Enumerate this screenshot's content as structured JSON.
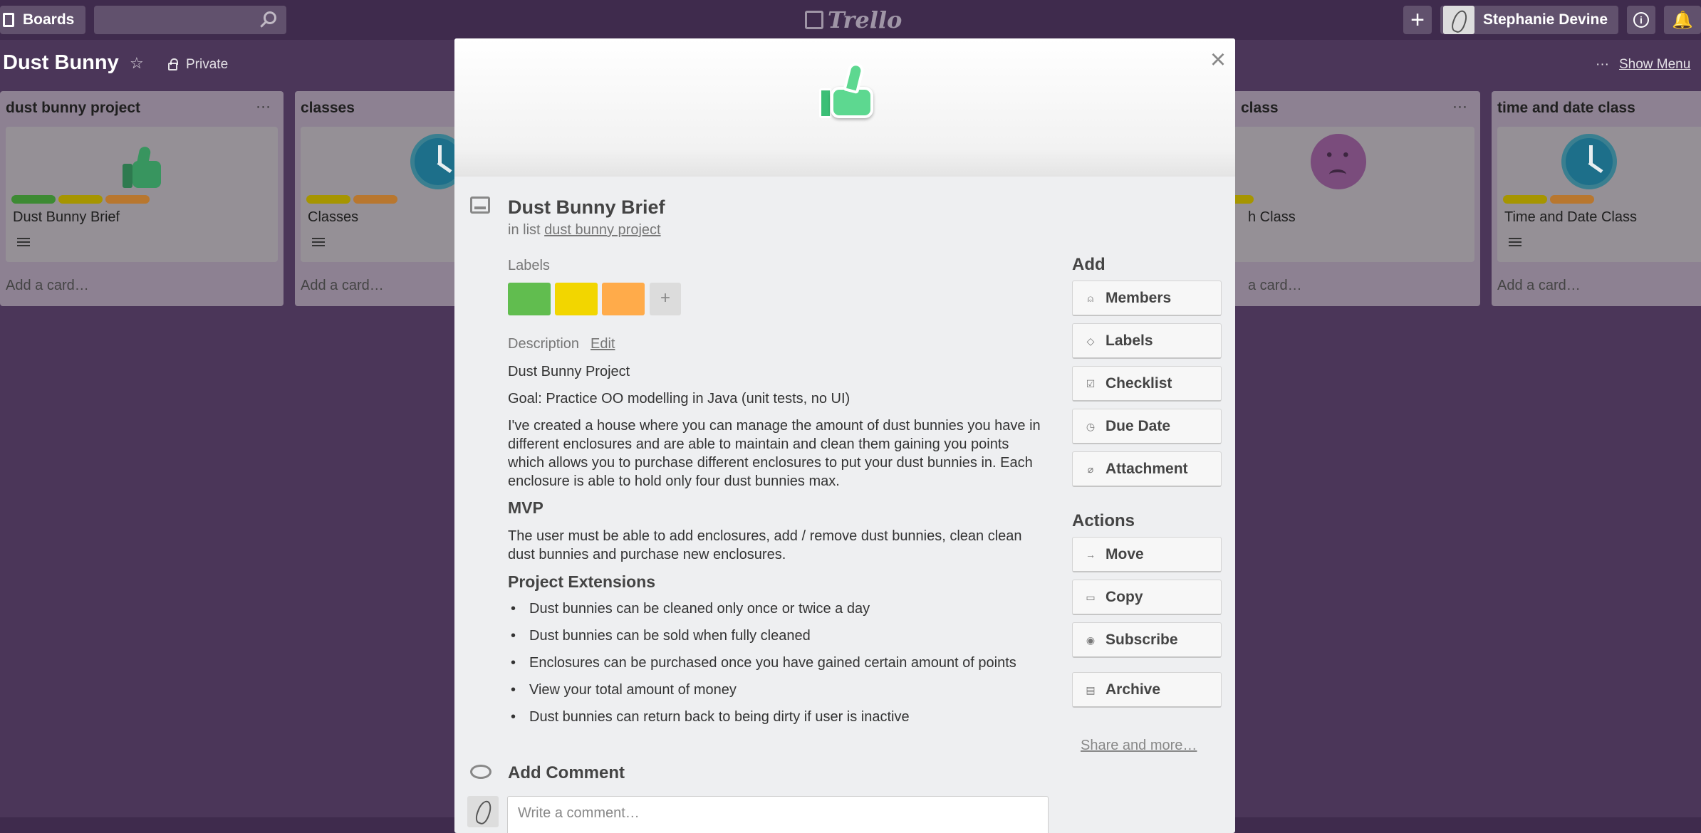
{
  "header": {
    "boards_label": "Boards",
    "logo_text": "Trello",
    "user_name": "Stephanie Devine"
  },
  "board": {
    "title": "Dust Bunny",
    "visibility": "Private",
    "show_menu": "Show Menu"
  },
  "lists": [
    {
      "title": "dust bunny project",
      "card_title": "Dust Bunny Brief",
      "add_card": "Add a card…",
      "cover": "thumbs-up-icon",
      "labels": [
        "#61bd4f",
        "#f2d600",
        "#ffab4a"
      ]
    },
    {
      "title": "classes",
      "card_title": "Classes",
      "add_card": "Add a card…",
      "cover": "clock-icon",
      "labels": [
        "#f2d600",
        "#ffab4a"
      ]
    },
    {
      "title": "class",
      "card_title": "h Class",
      "add_card": "a card…",
      "cover": "sad-face-icon",
      "labels": [
        "#f2d600"
      ]
    },
    {
      "title": "time and date class",
      "card_title": "Time and Date Class",
      "add_card": "Add a card…",
      "cover": "clock-icon",
      "labels": [
        "#f2d600",
        "#ffab4a"
      ]
    }
  ],
  "modal": {
    "title": "Dust Bunny Brief",
    "in_list_prefix": "in list",
    "list_name": "dust bunny project",
    "labels_heading": "Labels",
    "label_colors": [
      "#61bd4f",
      "#f2d600",
      "#ffab4a"
    ],
    "description_heading": "Description",
    "edit_label": "Edit",
    "description": {
      "line1": "Dust Bunny Project",
      "line2": "Goal: Practice OO modelling in Java (unit tests, no UI)",
      "paragraph": "I've created a house where you can manage the amount of dust bunnies you have in different enclosures and are able to maintain and clean them gaining you points which allows you to purchase different enclosures to put your dust bunnies in. Each enclosure is able to hold only four dust bunnies max.",
      "mvp_heading": "MVP",
      "mvp_text": "The user must be able to add enclosures, add / remove dust bunnies, clean clean dust bunnies and purchase new enclosures.",
      "extensions_heading": "Project Extensions",
      "extensions": [
        "Dust bunnies can be cleaned only once or twice a day",
        "Dust bunnies can be sold when fully cleaned",
        "Enclosures can be purchased once you have gained certain amount of points",
        "View your total amount of money",
        "Dust bunnies can return back to being dirty if user is inactive"
      ]
    },
    "add_comment_heading": "Add Comment",
    "comment_placeholder": "Write a comment…",
    "sidebar": {
      "add_heading": "Add",
      "add_buttons": [
        "Members",
        "Labels",
        "Checklist",
        "Due Date",
        "Attachment"
      ],
      "actions_heading": "Actions",
      "action_buttons": [
        "Move",
        "Copy",
        "Subscribe",
        "Archive"
      ],
      "share_link": "Share and more…"
    }
  }
}
